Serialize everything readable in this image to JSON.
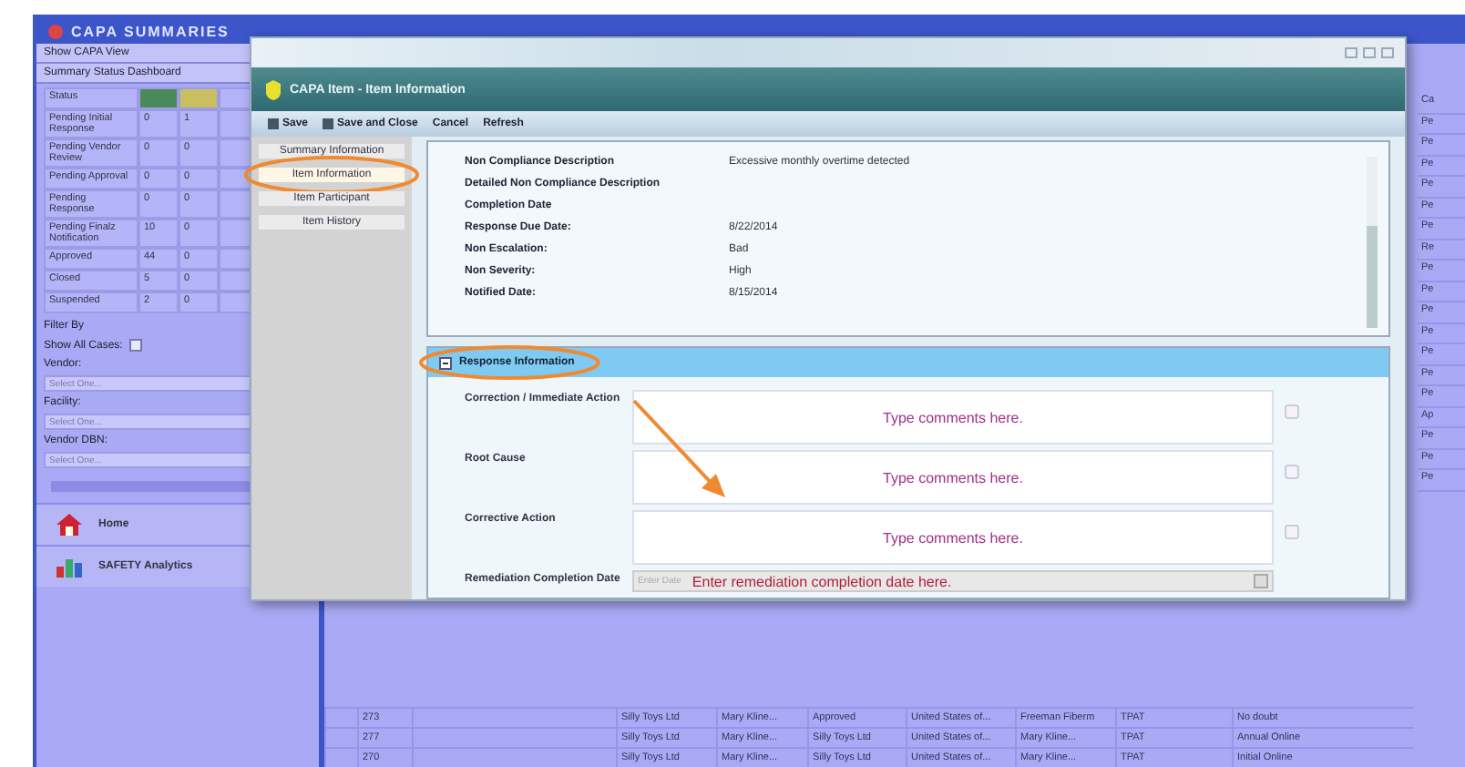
{
  "app": {
    "title": "CAPA SUMMARIES"
  },
  "left_panel": {
    "view_title": "Show CAPA View",
    "dashboard_title": "Summary Status Dashboard",
    "status_heading": "Status",
    "status_rows": [
      {
        "label": "Pending Initial Response",
        "col_1": "0",
        "col_2": "1"
      },
      {
        "label": "Pending Vendor Review",
        "col_1": "0",
        "col_2": "0"
      },
      {
        "label": "Pending Approval",
        "col_1": "0",
        "col_2": "0"
      },
      {
        "label": "Pending Response",
        "col_1": "0",
        "col_2": "0"
      },
      {
        "label": "Pending Finalz Notification",
        "col_1": "10",
        "col_2": "0"
      },
      {
        "label": "Approved",
        "col_1": "44",
        "col_2": "0"
      },
      {
        "label": "Closed",
        "col_1": "5",
        "col_2": "0"
      },
      {
        "label": "Suspended",
        "col_1": "2",
        "col_2": "0"
      }
    ],
    "filter_title": "Filter By",
    "show_all_label": "Show All Cases:",
    "show_all_checked": false,
    "filters": [
      {
        "label": "Vendor:",
        "placeholder": "Select One..."
      },
      {
        "label": "Facility:",
        "placeholder": "Select One..."
      },
      {
        "label": "Vendor DBN:",
        "placeholder": "Select One..."
      }
    ],
    "nav": [
      {
        "label": "Home",
        "kind": "home"
      },
      {
        "label": "SAFETY Analytics",
        "kind": "analytics"
      }
    ]
  },
  "right_strip": [
    "Ca",
    "Pe",
    "Pe",
    "Pe",
    "Pe",
    "Pe",
    "Pe",
    "Re",
    "Pe",
    "Pe",
    "Pe",
    "Pe",
    "Pe",
    "Pe",
    "Pe",
    "Ap",
    "Pe",
    "Pe",
    "Pe"
  ],
  "table_rows": [
    [
      "273",
      "Silly Toys Ltd",
      "Mary Kline...",
      "Approved",
      "United States of...",
      "Freeman Fiberm",
      "TPAT",
      "No doubt"
    ],
    [
      "277",
      "Silly Toys Ltd",
      "Mary Kline...",
      "Silly Toys Ltd",
      "United States of...",
      "Mary Kline...",
      "TPAT",
      "Annual Online"
    ],
    [
      "270",
      "Silly Toys Ltd",
      "Mary Kline...",
      "Silly Toys Ltd",
      "United States of...",
      "Mary Kline...",
      "TPAT",
      "Initial Online"
    ]
  ],
  "dialog": {
    "title": "CAPA Item - Item Information",
    "toolbar": [
      "Save",
      "Save and Close",
      "Cancel",
      "Refresh"
    ],
    "nav": [
      {
        "label": "Summary Information",
        "selected": false
      },
      {
        "label": "Item Information",
        "selected": true
      },
      {
        "label": "Item Participant",
        "selected": false
      },
      {
        "label": "Item History",
        "selected": false
      }
    ],
    "details": [
      {
        "label": "Non Compliance Description",
        "value": "Excessive monthly overtime detected"
      },
      {
        "label": "Detailed Non Compliance Description"
      },
      {
        "label": "Completion Date"
      },
      {
        "label": "Response Due Date:",
        "value": "8/22/2014"
      },
      {
        "label": "Non Escalation:",
        "value": "Bad"
      },
      {
        "label": "Non Severity:",
        "value": "High"
      },
      {
        "label": "Notified Date:",
        "value": "8/15/2014"
      }
    ],
    "section": {
      "title": "Response Information",
      "expanded": true
    },
    "fields": [
      {
        "label": "Correction / Immediate Action",
        "placeholder": "Type comments here."
      },
      {
        "label": "Root Cause",
        "placeholder": "Type comments here."
      },
      {
        "label": "Corrective Action",
        "placeholder": "Type comments here."
      }
    ],
    "date_field": {
      "label": "Remediation Completion Date",
      "placeholder": "Enter remediation completion date here.",
      "hint": "Enter Date"
    }
  }
}
